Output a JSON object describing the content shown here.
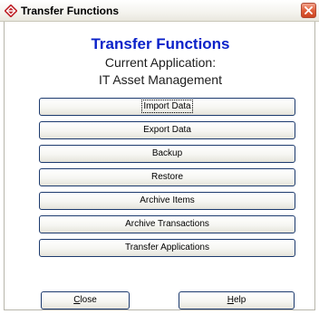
{
  "window": {
    "title": "Transfer Functions",
    "icon": "app-diamond-icon",
    "close_icon": "close-icon"
  },
  "header": {
    "heading": "Transfer Functions",
    "subtitle_line1": "Current Application:",
    "subtitle_line2": "IT Asset Management"
  },
  "actions": [
    {
      "label": "Import Data"
    },
    {
      "label": "Export Data"
    },
    {
      "label": "Backup"
    },
    {
      "label": "Restore"
    },
    {
      "label": "Archive Items"
    },
    {
      "label": "Archive Transactions"
    },
    {
      "label": "Transfer Applications"
    }
  ],
  "footer": {
    "close_first": "C",
    "close_rest": "lose",
    "help_first": "H",
    "help_rest": "elp"
  },
  "colors": {
    "heading": "#0b22c9",
    "close_button": "#e0603c",
    "button_border": "#1c3a6e"
  }
}
